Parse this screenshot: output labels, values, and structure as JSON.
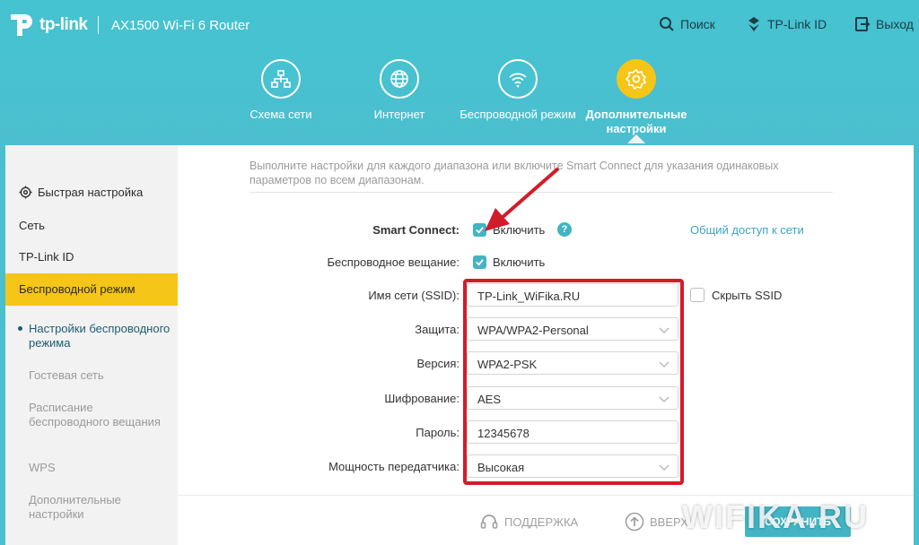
{
  "header": {
    "brand": "tp-link",
    "model": "AX1500 Wi-Fi 6 Router",
    "search": "Поиск",
    "tplink_id": "TP-Link ID",
    "logout": "Выход"
  },
  "main_nav": [
    {
      "label": "Схема сети",
      "icon": "network-map-icon"
    },
    {
      "label": "Интернет",
      "icon": "globe-icon"
    },
    {
      "label": "Беспроводной режим",
      "icon": "wifi-icon"
    },
    {
      "label": "Дополнительные настройки",
      "icon": "gear-icon",
      "active": true
    }
  ],
  "sidebar": {
    "items": [
      {
        "label": "Быстрая настройка",
        "icon": "gear-icon"
      },
      {
        "label": "Сеть"
      },
      {
        "label": "TP-Link ID"
      },
      {
        "label": "Беспроводной режим",
        "active": true
      }
    ],
    "sub_items": [
      {
        "label": "Настройки беспроводного режима",
        "current": true
      },
      {
        "label": "Гостевая сеть"
      },
      {
        "label": "Расписание беспроводного вещания"
      },
      {
        "label": "WPS"
      },
      {
        "label": "Дополнительные настройки"
      }
    ]
  },
  "content": {
    "intro": "Выполните настройки для каждого диапазона или включите Smart Connect для указания одинаковых параметров по всем диапазонам.",
    "smart_connect_label": "Smart Connect:",
    "smart_connect_value": "Включить",
    "share_network_link": "Общий доступ к сети",
    "broadcast_label": "Беспроводное вещание:",
    "broadcast_value": "Включить",
    "ssid_label": "Имя сети (SSID):",
    "ssid_value": "TP-Link_WiFika.RU",
    "hide_ssid": "Скрыть SSID",
    "security_label": "Защита:",
    "security_value": "WPA/WPA2-Personal",
    "version_label": "Версия:",
    "version_value": "WPA2-PSK",
    "encryption_label": "Шифрование:",
    "encryption_value": "AES",
    "password_label": "Пароль:",
    "password_value": "12345678",
    "power_label": "Мощность передатчика:",
    "power_value": "Высокая"
  },
  "footer": {
    "support": "ПОДДЕРЖКА",
    "up": "ВВЕРХ",
    "save": "СОХРАНИТЬ"
  },
  "watermark": "WIFIKA.RU",
  "colors": {
    "header_bg": "#45c3d1",
    "accent_yellow": "#f5c518",
    "accent_teal": "#43b4c4",
    "highlight_red": "#d21c2a"
  }
}
